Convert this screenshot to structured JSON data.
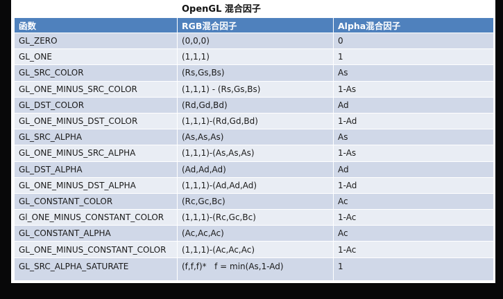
{
  "title": "OpenGL 混合因子",
  "columns": [
    "函数",
    "RGB混合因子",
    "Alpha混合因子"
  ],
  "rows": [
    [
      "GL_ZERO",
      "(0,0,0)",
      "0"
    ],
    [
      "GL_ONE",
      "(1,1,1)",
      "1"
    ],
    [
      "GL_SRC_COLOR",
      "(Rs,Gs,Bs)",
      "As"
    ],
    [
      "GL_ONE_MINUS_SRC_COLOR",
      "(1,1,1) - (Rs,Gs,Bs)",
      "1-As"
    ],
    [
      "GL_DST_COLOR",
      "(Rd,Gd,Bd)",
      "Ad"
    ],
    [
      "GL_ONE_MINUS_DST_COLOR",
      "(1,1,1)-(Rd,Gd,Bd)",
      "1-Ad"
    ],
    [
      "GL_SRC_ALPHA",
      "(As,As,As)",
      "As"
    ],
    [
      "GL_ONE_MINUS_SRC_ALPHA",
      "(1,1,1)-(As,As,As)",
      "1-As"
    ],
    [
      "GL_DST_ALPHA",
      "(Ad,Ad,Ad)",
      "Ad"
    ],
    [
      "GL_ONE_MINUS_DST_ALPHA",
      "(1,1,1)-(Ad,Ad,Ad)",
      "1-Ad"
    ],
    [
      "GL_CONSTANT_COLOR",
      "(Rc,Gc,Bc)",
      "Ac"
    ],
    [
      "Gl_ONE_MINUS_CONSTANT_COLOR",
      "(1,1,1)-(Rc,Gc,Bc)",
      "1-Ac"
    ],
    [
      "GL_CONSTANT_ALPHA",
      "(Ac,Ac,Ac)",
      "Ac"
    ],
    [
      "GL_ONE_MINUS_CONSTANT_COLOR",
      "(1,1,1)-(Ac,Ac,Ac)",
      "1-Ac"
    ],
    [
      "GL_SRC_ALPHA_SATURATE",
      "(f,f,f)*   f = min(As,1-Ad)",
      "1"
    ]
  ],
  "colors": {
    "header_bg": "#4f81bd",
    "row_odd": "#d0d8e8",
    "row_even": "#e9edf4",
    "background": "#080809"
  }
}
